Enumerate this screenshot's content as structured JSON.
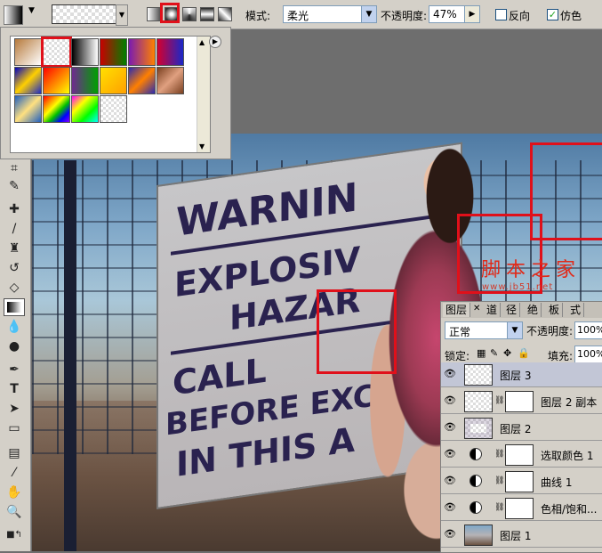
{
  "optbar": {
    "mode_label": "模式:",
    "mode_value": "柔光",
    "opacity_label": "不透明度:",
    "opacity_value": "47%",
    "reverse_label": "反向",
    "dither_label": "仿色",
    "dither_checked": true,
    "reverse_checked": false
  },
  "picker": {
    "swatches": [
      "linear-gradient(135deg,#b77a3c,#fff)",
      "transparent-checker",
      "linear-gradient(90deg,#000,#fff)",
      "linear-gradient(90deg,#c80000,#008000)",
      "linear-gradient(90deg,#7a1bb0,#ff8000)",
      "linear-gradient(90deg,#d4002e,#1a28c8)",
      "linear-gradient(135deg,#0000c0,#ffd000,#1a28c8)",
      "linear-gradient(135deg,#ff0000,#ffff00)",
      "linear-gradient(90deg,#6f2a90,#00a000)",
      "linear-gradient(135deg,#ffe000,#ffa000)",
      "linear-gradient(135deg,#2a2ab0,#ff8000,#2a2ab0)",
      "linear-gradient(135deg,#7a4020,#e0a080,#7a4020)",
      "linear-gradient(135deg,#2060c0,#ffe080,#2060c0)",
      "linear-gradient(135deg,#ff0000,#ff8000,#ffff00,#00c000,#0000ff,#8000ff)",
      "linear-gradient(135deg,#ff00ff,#ffff00,#00ff00,#00ffff)",
      "checker-fade"
    ]
  },
  "layers": {
    "tabs": [
      "图层",
      "道",
      "径",
      "绝",
      "板",
      "式"
    ],
    "blend_mode": "正常",
    "opacity_label": "不透明度:",
    "opacity_value": "100%",
    "lock_label": "锁定:",
    "fill_label": "填充:",
    "fill_value": "100%",
    "rows": [
      {
        "name": "图层 3",
        "kind": "layer",
        "selected": true
      },
      {
        "name": "图层 2 副本",
        "kind": "layer-mask"
      },
      {
        "name": "图层 2",
        "kind": "layer"
      },
      {
        "name": "选取颜色 1",
        "kind": "adjustment"
      },
      {
        "name": "曲线 1",
        "kind": "adjustment"
      },
      {
        "name": "色相/饱和...",
        "kind": "adjustment"
      },
      {
        "name": "图层 1",
        "kind": "photo"
      }
    ]
  },
  "canvas": {
    "sign_lines": [
      "WARNIN",
      "EXPLOSIV",
      "HAZAR",
      "CALL",
      "BEFORE EXCAVA",
      "IN THIS A"
    ],
    "watermark": "脚本之家",
    "watermark_url": "www.jb51.net"
  },
  "colors": {
    "highlight_red": "#e0101a",
    "panel_bg": "#d4d0c8",
    "selected_row": "#c2c6d6"
  }
}
